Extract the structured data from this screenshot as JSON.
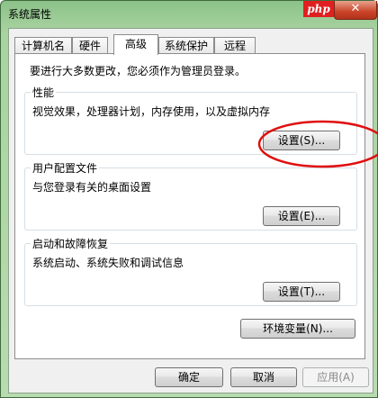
{
  "window": {
    "title": "系统属性",
    "logo_text": "php",
    "close_symbol": "✕"
  },
  "tabs": [
    {
      "label": "计算机名",
      "active": false
    },
    {
      "label": "硬件",
      "active": false
    },
    {
      "label": "高级",
      "active": true
    },
    {
      "label": "系统保护",
      "active": false
    },
    {
      "label": "远程",
      "active": false
    }
  ],
  "advanced": {
    "intro": "要进行大多数更改，您必须作为管理员登录。",
    "performance": {
      "title": "性能",
      "description": "视觉效果，处理器计划，内存使用，以及虚拟内存",
      "button": "设置(S)..."
    },
    "user_profiles": {
      "title": "用户配置文件",
      "description": "与您登录有关的桌面设置",
      "button": "设置(E)..."
    },
    "startup_recovery": {
      "title": "启动和故障恢复",
      "description": "系统启动、系统失败和调试信息",
      "button": "设置(T)..."
    },
    "env_button": "环境变量(N)..."
  },
  "footer": {
    "ok": "确定",
    "cancel": "取消",
    "apply": "应用(A)"
  },
  "colors": {
    "annotation": "#e01010",
    "frame_green": "#a9d3a0"
  }
}
